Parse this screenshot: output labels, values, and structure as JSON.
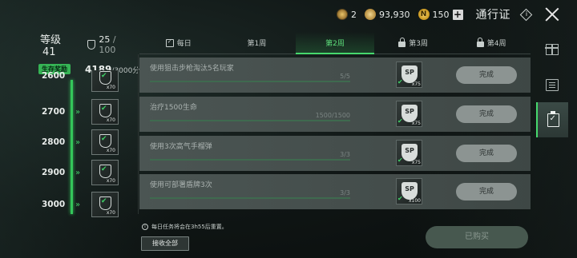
{
  "topbar": {
    "badge_count": "2",
    "gold_amount": "93,930",
    "n_coin_amount": "150",
    "n_coin_symbol": "N",
    "plus_label": "+",
    "title": "通行证",
    "info_symbol": "i"
  },
  "level_panel": {
    "label": "等级",
    "level": "41",
    "xp_current": "25",
    "xp_max": "/ 100",
    "survival_label": "生存奖励",
    "survival_value": "4189",
    "survival_total": "/3000分钟",
    "progress_fraction": 1.0,
    "rows": [
      {
        "level": "2600",
        "qty": "x70"
      },
      {
        "level": "2700",
        "qty": "x70"
      },
      {
        "level": "2800",
        "qty": "x70"
      },
      {
        "level": "2900",
        "qty": "x70"
      },
      {
        "level": "3000",
        "qty": "x70"
      }
    ]
  },
  "tabs": [
    {
      "label": "每日",
      "icon": "calendar-check-icon",
      "active": false
    },
    {
      "label": "第1周",
      "icon": "",
      "active": false
    },
    {
      "label": "第2周",
      "icon": "",
      "active": true
    },
    {
      "label": "第3周",
      "icon": "lock-icon",
      "active": false
    },
    {
      "label": "第4周",
      "icon": "lock-icon",
      "active": false
    }
  ],
  "tasks": [
    {
      "name": "使用狙击步枪淘汰5名玩家",
      "progress": "5/5",
      "reward": "SP",
      "reward_qty": "x75",
      "button": "完成"
    },
    {
      "name": "治疗1500生命",
      "progress": "1500/1500",
      "reward": "SP",
      "reward_qty": "x75",
      "button": "完成"
    },
    {
      "name": "使用3次高气手榴弹",
      "progress": "3/3",
      "reward": "SP",
      "reward_qty": "x75",
      "button": "完成"
    },
    {
      "name": "使用可部署盾牌3次",
      "progress": "3/3",
      "reward": "SP",
      "reward_qty": "x100",
      "button": "完成"
    }
  ],
  "footer": {
    "note": "每日任务将会在3h55后重置。",
    "claim_all": "接收全部",
    "purchased": "已购买"
  },
  "rail": [
    "gift-icon",
    "book-icon",
    "clipboard-check-icon"
  ],
  "colors": {
    "accent": "#46d86d",
    "task_bg": "#4b5553",
    "done_btn": "#8c9492"
  }
}
